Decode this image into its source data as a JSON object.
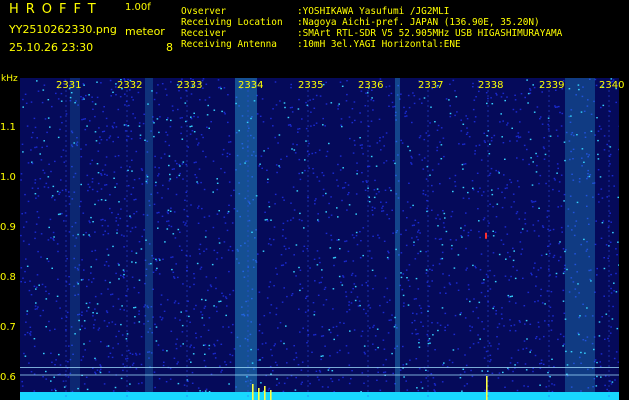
{
  "header": {
    "app_title": "HROFFT",
    "version": "1.00f",
    "filename": "YY2510262330.png",
    "datetime": "25.10.26 23:30",
    "meteor_label": "meteor",
    "meteor_count": "8"
  },
  "info": [
    {
      "key": "Ovserver",
      "value": ":YOSHIKAWA Yasufumi /JG2MLI"
    },
    {
      "key": "Receiving Location",
      "value": ":Nagoya Aichi-pref. JAPAN (136.90E, 35.20N)"
    },
    {
      "key": "Receiver",
      "value": ":SMArt RTL-SDR V5 52.905MHz USB HIGASHIMURAYAMA"
    },
    {
      "key": "Receiving Antenna",
      "value": ":10mH 3el.YAGI Horizontal:ENE"
    }
  ],
  "chart_data": {
    "type": "heatmap",
    "y_unit": "kHz",
    "y_ticks": [
      "1.1",
      "1.0",
      "0.9",
      "0.8",
      "0.7",
      "0.6"
    ],
    "x_ticks": [
      "2331",
      "2332",
      "2333",
      "2334",
      "2335",
      "2336",
      "2337",
      "2338",
      "2339",
      "2340"
    ],
    "ylim": [
      0.57,
      1.2
    ],
    "colors": {
      "background": "#050a5a",
      "noise_low": "#1a2ad0",
      "noise_high": "#35d0ff",
      "label": "#ffff00",
      "echo": "#ff3030"
    }
  }
}
